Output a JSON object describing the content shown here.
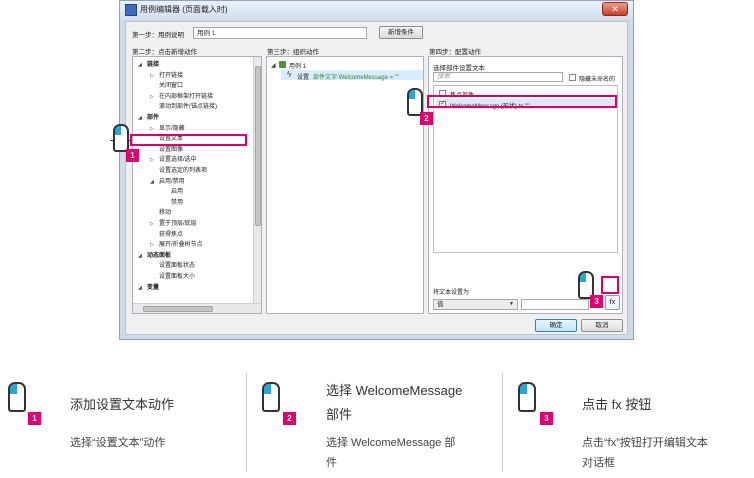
{
  "dialog": {
    "title": "用例编辑器 (页面载入时)",
    "close_glyph": "✕",
    "step1_label": "第一步：用例说明",
    "case_name_value": "用例 1",
    "add_condition_button": "新增条件",
    "step2_label": "第二步：点击新增动作",
    "step3_label": "第三步：组织动作",
    "step4_label": "第四步：配置动作",
    "ok_button": "确定",
    "cancel_button": "取消"
  },
  "actions_tree": [
    {
      "label": "链接",
      "bold": true,
      "arrow": "◢"
    },
    {
      "label": "打开链接",
      "arrow": "▷"
    },
    {
      "label": "关闭窗口",
      "arrow": ""
    },
    {
      "label": "在内部框架打开链接",
      "arrow": "▷"
    },
    {
      "label": "滚动到部件(锚点链接)",
      "arrow": ""
    },
    {
      "label": "部件",
      "bold": true,
      "arrow": "◢"
    },
    {
      "label": "显示/隐藏",
      "arrow": "▷"
    },
    {
      "label": "设置文本",
      "arrow": ""
    },
    {
      "label": "设置图像",
      "arrow": ""
    },
    {
      "label": "设置选择/选中",
      "arrow": "▷"
    },
    {
      "label": "设置选定的列表项",
      "arrow": ""
    },
    {
      "label": "启用/禁用",
      "arrow": "◢"
    },
    {
      "label": "启用",
      "arrow": ""
    },
    {
      "label": "禁用",
      "arrow": ""
    },
    {
      "label": "移动",
      "arrow": ""
    },
    {
      "label": "置于顶层/底层",
      "arrow": "▷"
    },
    {
      "label": "获得焦点",
      "arrow": ""
    },
    {
      "label": "展开/折叠树节点",
      "arrow": "▷"
    },
    {
      "label": "动态面板",
      "bold": true,
      "arrow": "◢"
    },
    {
      "label": "设置面板状态",
      "arrow": ""
    },
    {
      "label": "设置面板大小",
      "arrow": ""
    },
    {
      "label": "变量",
      "bold": true,
      "arrow": "◢"
    }
  ],
  "organize": {
    "case_label": "用例 1",
    "action_prefix": "设置",
    "action_detail": "部件文字 WelcomeMessage = \"\""
  },
  "config": {
    "select_widget_label": "选择部件设置文本",
    "search_placeholder": "搜索",
    "hide_unnamed_label": "隐藏未命名的",
    "focus_widget_label": "焦点部件",
    "widget_item_label": "WelcomeMessage (形状) to \"\"",
    "set_text_to_label": "将文本设置为",
    "value_type": "值",
    "fx_button": "fx"
  },
  "badges": [
    "1",
    "2",
    "3"
  ],
  "legend": [
    {
      "num": "1",
      "title": "添加设置文本动作",
      "desc": "选择“设置文本”动作"
    },
    {
      "num": "2",
      "title_line1": "选择 WelcomeMessage",
      "title_line2": "部件",
      "desc_line1": "选择 WelcomeMessage 部",
      "desc_line2": "件"
    },
    {
      "num": "3",
      "title": "点击 fx  按钮",
      "desc_line1": "点击“fx”按钮打开编辑文本",
      "desc_line2": "对话框"
    }
  ],
  "colors": {
    "highlight": "#d6006e",
    "mouse_button": "#2aa6d6",
    "badge": "#e0006f",
    "selected_row": "#dde7f7"
  }
}
